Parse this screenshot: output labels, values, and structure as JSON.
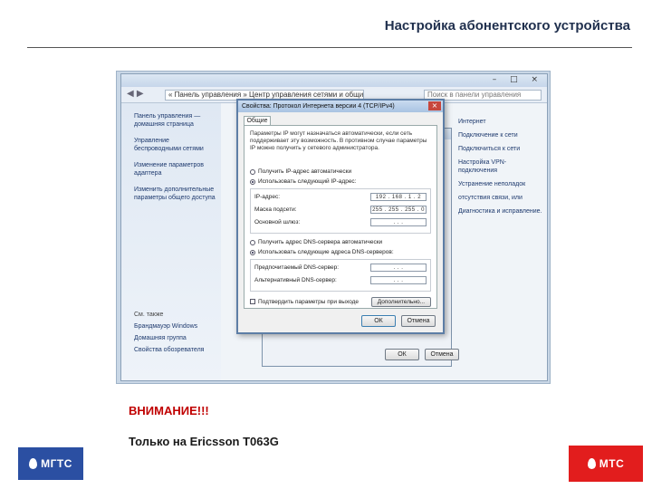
{
  "slide": {
    "title": "Настройка абонентского устройства",
    "warning": "ВНИМАНИЕ!!!",
    "note": "Только на Ericsson T063G"
  },
  "explorer": {
    "window_controls": "– □ ×",
    "nav_arrows": "◀ ▶",
    "breadcrumb": "« Панель управления » Центр управления сетями и общим доступом",
    "search_placeholder": "Поиск в панели управления",
    "left_links": [
      "Панель управления — домашняя страница",
      "Управление беспроводными сетями",
      "Изменение параметров адаптера",
      "Изменить дополнительные параметры общего доступа"
    ],
    "see_also": "См. также",
    "see_also_links": [
      "Брандмауэр Windows",
      "Домашняя группа",
      "Свойства обозревателя"
    ],
    "right_fragments": [
      "Интернет",
      "Подключение к сети",
      "Подключиться к сети",
      "Настройка VPN-подключения",
      "Устранение неполадок",
      "отсутствия связи, или",
      "Диагностика и исправление."
    ]
  },
  "props_window": {
    "ok": "ОК",
    "cancel": "Отмена"
  },
  "ipv4_dialog": {
    "title": "Свойства: Протокол Интернета версии 4 (TCP/IPv4)",
    "close": "×",
    "tab": "Общие",
    "description": "Параметры IP могут назначаться автоматически, если сеть поддерживает эту возможность. В противном случае параметры IP можно получить у сетевого администратора.",
    "radio_auto_ip": "Получить IP-адрес автоматически",
    "radio_manual_ip": "Использовать следующий IP-адрес:",
    "ip_label": "IP-адрес:",
    "ip_value": "192 . 168 . 1 . 2",
    "mask_label": "Маска подсети:",
    "mask_value": "255 . 255 . 255 . 0",
    "gateway_label": "Основной шлюз:",
    "gateway_value": ". . .",
    "radio_auto_dns": "Получить адрес DNS-сервера автоматически",
    "radio_manual_dns": "Использовать следующие адреса DNS-серверов:",
    "dns1_label": "Предпочитаемый DNS-сервер:",
    "dns1_value": ". . .",
    "dns2_label": "Альтернативный DNS-сервер:",
    "dns2_value": ". . .",
    "validate_label": "Подтвердить параметры при выходе",
    "advanced_button": "Дополнительно...",
    "ok": "ОК",
    "cancel": "Отмена"
  },
  "logos": {
    "left": "МГТС",
    "right": "МТС",
    "left_color": "#2b4fa2",
    "right_color": "#e21d1d"
  }
}
